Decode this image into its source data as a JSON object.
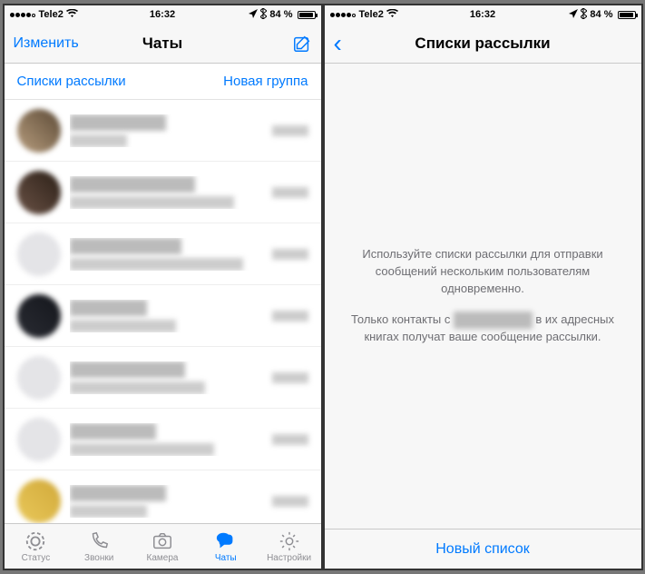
{
  "status": {
    "carrier": "Tele2",
    "signal_dots": 5,
    "time": "16:32",
    "battery_pct": "84 %",
    "location_icon": "location-arrow",
    "bluetooth_icon": "bluetooth",
    "wifi_icon": "wifi"
  },
  "left_screen": {
    "nav": {
      "edit": "Изменить",
      "title": "Чаты",
      "compose_icon": "compose-icon"
    },
    "subrow": {
      "broadcast": "Списки рассылки",
      "newgroup": "Новая группа"
    },
    "tabs": {
      "status": "Статус",
      "calls": "Звонки",
      "camera": "Камера",
      "chats": "Чаты",
      "settings": "Настройки"
    },
    "chat_rows": 7
  },
  "right_screen": {
    "nav": {
      "title": "Списки рассылки"
    },
    "empty_text_1": "Используйте списки рассылки для отправки сообщений нескольким пользователям одновременно.",
    "empty_text_2a": "Только контакты с ",
    "empty_text_2b": " в их адресных книгах получат ваше сообщение рассылки.",
    "bottom_button": "Новый список"
  },
  "colors": {
    "accent": "#007aff",
    "highlight": "#e0332c"
  }
}
